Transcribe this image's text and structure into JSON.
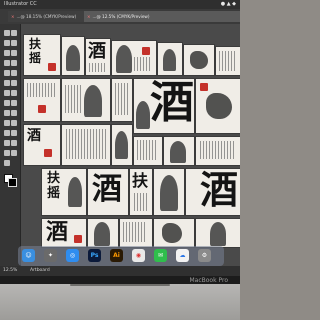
{
  "window": {
    "menubar_app": "Illustrator CC",
    "tab1_label": "...@ 18.15% (CMYK/Preview)",
    "tab2_label": "...@ 12.5% (CMYK/Preview)"
  },
  "statusbar": {
    "zoom": "12.5%",
    "mode": "Artboard"
  },
  "laptop": {
    "brand": "MacBook Pro"
  },
  "artboards": {
    "glyph_jiu": "酒",
    "glyph_fu": "扶",
    "glyph_yao": "摇"
  },
  "dock": {
    "icons": [
      "finder-icon",
      "launchpad-icon",
      "safari-icon",
      "photoshop-icon",
      "illustrator-icon",
      "chrome-icon",
      "messages-icon",
      "baidu-netdisk-icon",
      "system-preferences-icon"
    ],
    "ps_label": "Ps",
    "ai_label": "Ai"
  }
}
